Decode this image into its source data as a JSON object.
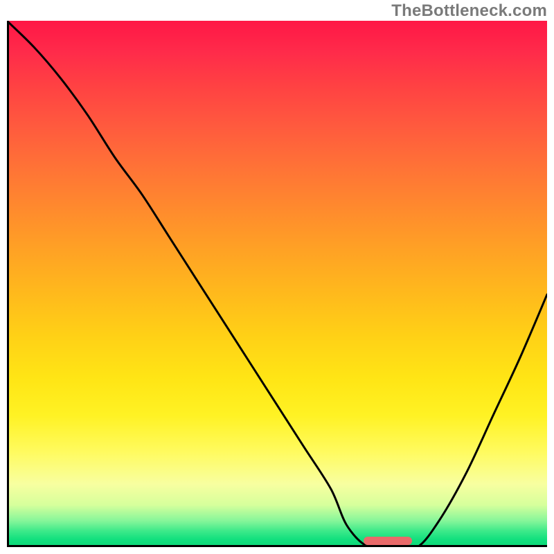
{
  "watermark": "TheBottleneck.com",
  "colors": {
    "curve": "#000000",
    "axis": "#000000",
    "marker": "#e96a6a"
  },
  "chart_data": {
    "type": "line",
    "title": "",
    "xlabel": "",
    "ylabel": "",
    "xlim": [
      0,
      100
    ],
    "ylim": [
      0,
      100
    ],
    "grid": false,
    "legend": false,
    "background": "vertical-heat-gradient (red top → green bottom)",
    "series": [
      {
        "name": "bottleneck-curve",
        "x": [
          0,
          5,
          10,
          15,
          20,
          25,
          30,
          35,
          40,
          45,
          50,
          55,
          60,
          63,
          67,
          72,
          76,
          80,
          85,
          90,
          95,
          100
        ],
        "y": [
          100,
          95,
          89,
          82,
          74,
          67,
          59,
          51,
          43,
          35,
          27,
          19,
          11,
          4,
          0,
          0,
          0,
          5,
          14,
          25,
          36,
          48
        ]
      }
    ],
    "annotations": [
      {
        "name": "optimal-range-marker",
        "x_start": 66,
        "x_end": 75,
        "y": 0
      }
    ]
  }
}
